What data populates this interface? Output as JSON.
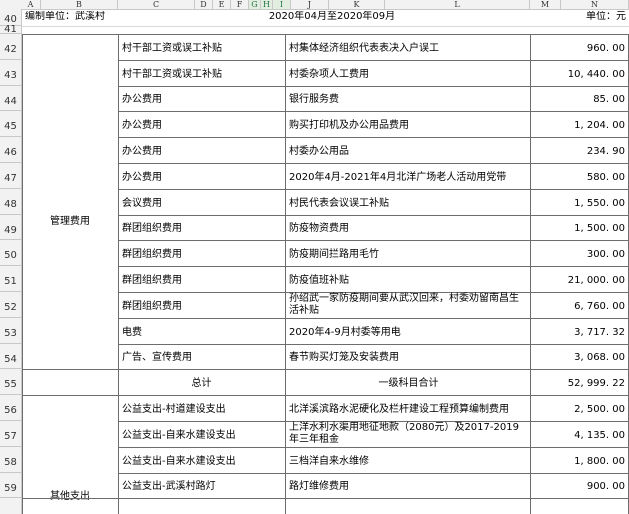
{
  "columns": [
    "A",
    "B",
    "C",
    "D",
    "E",
    "F",
    "G",
    "H",
    "I",
    "J",
    "K",
    "L",
    "M",
    "N"
  ],
  "header": {
    "unit_label": "编制单位：武溪村",
    "period": "2020年04月至2020年09月",
    "currency": "单位：元"
  },
  "row_numbers": [
    "40",
    "41",
    "42",
    "43",
    "44",
    "45",
    "46",
    "47",
    "48",
    "49",
    "50",
    "51",
    "52",
    "53",
    "54",
    "55",
    "56",
    "57",
    "58",
    "59"
  ],
  "sections": {
    "management": "管理费用",
    "other": "其他支出"
  },
  "rows": [
    {
      "category": "村干部工资或误工补贴",
      "detail": "村集体经济组织代表表决入户误工",
      "amount": "960. 00"
    },
    {
      "category": "村干部工资或误工补贴",
      "detail": "村委杂项人工费用",
      "amount": "10, 440. 00"
    },
    {
      "category": "办公费用",
      "detail": "银行服务费",
      "amount": "85. 00"
    },
    {
      "category": "办公费用",
      "detail": "购买打印机及办公用品费用",
      "amount": "1, 204. 00"
    },
    {
      "category": "办公费用",
      "detail": "村委办公用品",
      "amount": "234. 90"
    },
    {
      "category": "办公费用",
      "detail": "2020年4月-2021年4月北洋广场老人活动用党带",
      "amount": "580. 00"
    },
    {
      "category": "会议费用",
      "detail": "村民代表会议误工补贴",
      "amount": "1, 550. 00"
    },
    {
      "category": "群团组织费用",
      "detail": "防疫物资费用",
      "amount": "1, 500. 00"
    },
    {
      "category": "群团组织费用",
      "detail": "防疫期间拦路用毛竹",
      "amount": "300. 00"
    },
    {
      "category": "群团组织费用",
      "detail": "防疫值班补贴",
      "amount": "21, 000. 00"
    },
    {
      "category": "群团组织费用",
      "detail": "孙绍武一家防疫期间要从武汉回来，村委劝留南昌生活补贴",
      "amount": "6, 760. 00"
    },
    {
      "category": "电费",
      "detail": "2020年4-9月村委等用电",
      "amount": "3, 717. 32"
    },
    {
      "category": "广告、宣传费用",
      "detail": "春节购买灯笼及安装费用",
      "amount": "3, 068. 00"
    },
    {
      "category": "总计",
      "detail": "一级科目合计",
      "amount": "52, 999. 22"
    },
    {
      "category": "公益支出-村道建设支出",
      "detail": "北洋溪滨路水泥硬化及栏杆建设工程预算编制费用",
      "amount": "2, 500. 00"
    },
    {
      "category": "公益支出-自来水建设支出",
      "detail": "上洋水利水渠用地征地款（2080元）及2017-2019年三年租金",
      "amount": "4, 135. 00"
    },
    {
      "category": "公益支出-自来水建设支出",
      "detail": "三档洋自来水维修",
      "amount": "1, 800. 00"
    },
    {
      "category": "公益支出-武溪村路灯",
      "detail": "路灯维修费用",
      "amount": "900. 00"
    }
  ]
}
